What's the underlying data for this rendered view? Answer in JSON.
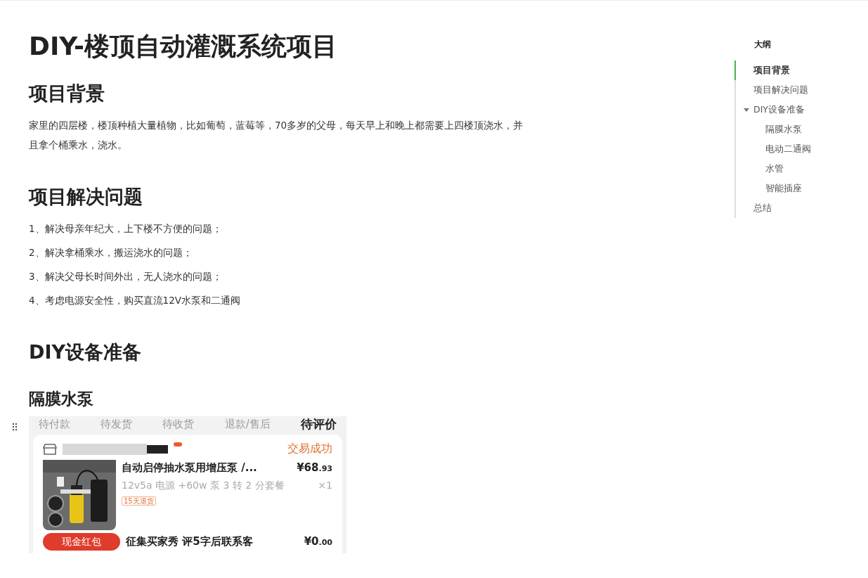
{
  "blocks": [
    {
      "kind": "h1",
      "text": "DIY-楼顶自动灌溉系统项目"
    },
    {
      "kind": "h2",
      "text": "项目背景"
    },
    {
      "kind": "p",
      "text": "家里的四层楼，楼顶种植大量植物，比如葡萄，蓝莓等，70多岁的父母，每天早上和晚上都需要上四楼顶浇水，并且拿个桶乘水，浇水。"
    },
    {
      "kind": "h2",
      "text": "项目解决问题"
    },
    {
      "kind": "p",
      "text": "1、解决母亲年纪大，上下楼不方便的问题；"
    },
    {
      "kind": "p",
      "text": "2、解决拿桶乘水，搬运浇水的问题；"
    },
    {
      "kind": "p",
      "text": "3、解决父母长时间外出，无人浇水的问题；"
    },
    {
      "kind": "p",
      "text": "4、考虑电源安全性，购买直流12V水泵和二通阀"
    },
    {
      "kind": "h2",
      "text": "DIY设备准备"
    },
    {
      "kind": "h3",
      "text": "隔膜水泵"
    },
    {
      "kind": "screenshot",
      "tabs": [
        {
          "label": "待付款",
          "selected": false
        },
        {
          "label": "待发货",
          "selected": false
        },
        {
          "label": "待收货",
          "selected": false
        },
        {
          "label": "退款/售后",
          "selected": false
        },
        {
          "label": "待评价",
          "selected": true
        }
      ],
      "order": {
        "status": "交易成功",
        "product": {
          "title": "自动启停抽水泵用增压泵 /...",
          "spec": "12v5a 电源 +60w 泵 3 转 2 分套餐",
          "price": "¥68.93",
          "quantity": "×1",
          "tag": "15天退货"
        },
        "extra": {
          "button": "现金红包",
          "title": "征集买家秀 评5字后联系客",
          "price": "¥0.00"
        }
      }
    }
  ],
  "outline": {
    "title": "大纲",
    "items": [
      {
        "label": "项目背景",
        "selected": true
      },
      {
        "label": "项目解决问题",
        "selected": false
      },
      {
        "label": "DIY设备准备",
        "selected": false,
        "expanded": true,
        "children": [
          {
            "label": "隔膜水泵",
            "selected": false
          },
          {
            "label": "电动二通阀",
            "selected": false
          },
          {
            "label": "水管",
            "selected": false
          },
          {
            "label": "智能插座",
            "selected": false
          }
        ]
      },
      {
        "label": "总结",
        "selected": false
      }
    ]
  }
}
